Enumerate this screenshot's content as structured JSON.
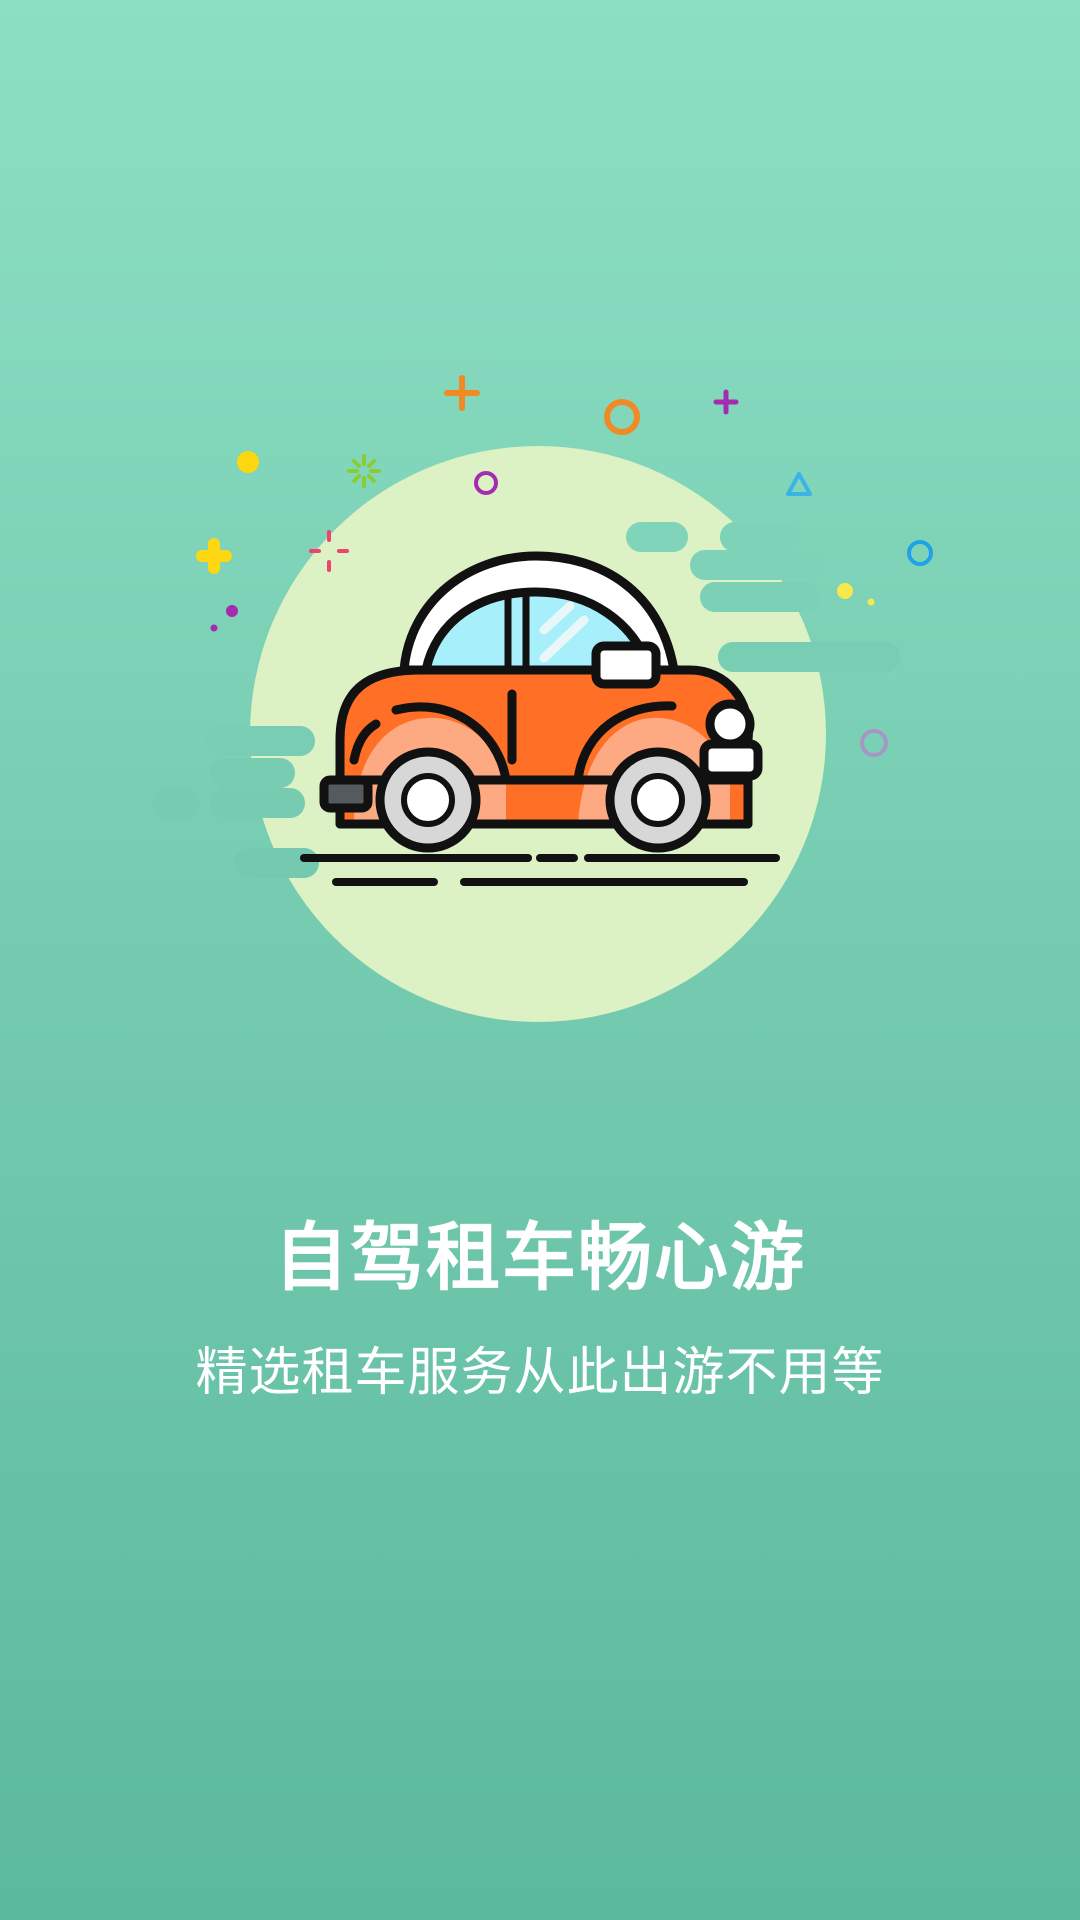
{
  "splash": {
    "title": "自驾租车畅心游",
    "subtitle": "精选租车服务从此出游不用等"
  },
  "illustration": {
    "subject": "car-illustration",
    "colors": {
      "background_top": "#8ddfc3",
      "background_bottom": "#5bb99c",
      "circle": "#dcf1c4",
      "car_body": "#ff7026",
      "car_roof": "#ffffff",
      "window": "#a7f0fb",
      "wheel_rim": "#d7d7d7"
    }
  }
}
